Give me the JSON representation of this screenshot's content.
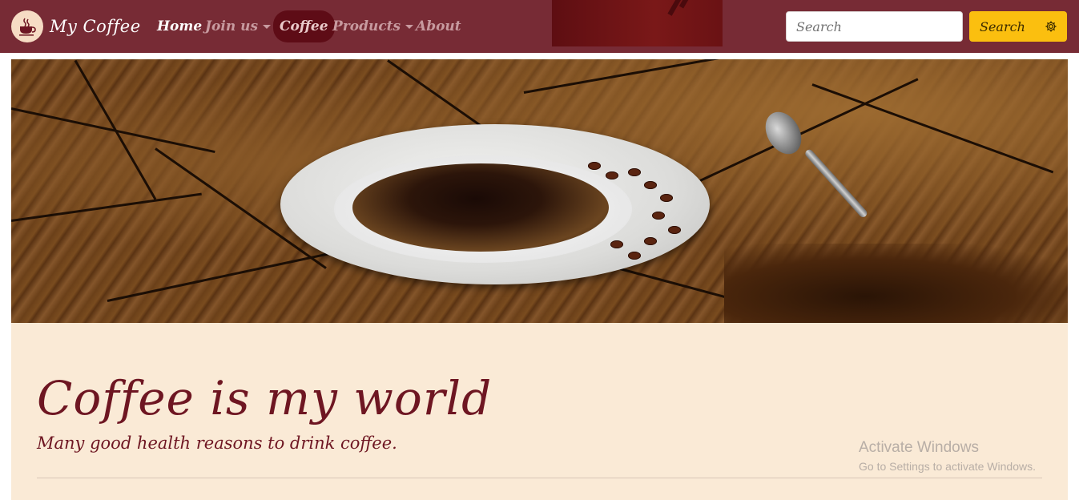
{
  "navbar": {
    "brand_name": "My Coffee",
    "brand_icon": "coffee-cup-icon",
    "links": {
      "home": "Home",
      "join_us": "Join us",
      "coffee": "Coffee",
      "products": "Products",
      "about": "About"
    },
    "search_placeholder": "Search",
    "search_button_label": "Search",
    "search_button_icon": "gear-icon",
    "colors": {
      "background": "#772b35",
      "active_pill": "#5e0c16",
      "search_button": "#fbbf0f"
    }
  },
  "hero": {
    "image_subject": "coffee-cup-on-wood-table"
  },
  "jumbotron": {
    "title": "Coffee is my world",
    "subtitle": "Many good health reasons to drink coffee.",
    "colors": {
      "background": "#faead6",
      "text": "#6e1622"
    }
  },
  "watermark": {
    "title": "Activate Windows",
    "subtitle": "Go to Settings to activate Windows."
  }
}
